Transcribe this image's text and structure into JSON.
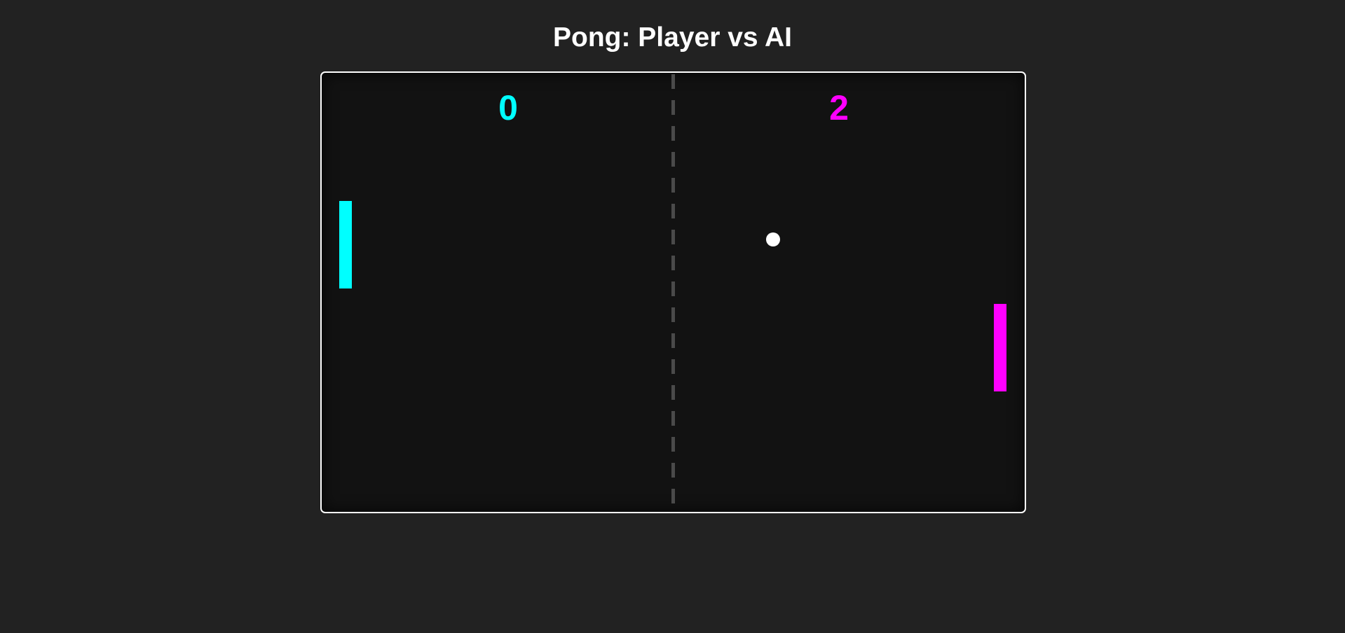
{
  "title": "Pong: Player vs AI",
  "scores": {
    "player": "0",
    "ai": "2"
  },
  "colors": {
    "background": "#222222",
    "board": "#121212",
    "border": "#ffffff",
    "player": "#00ffff",
    "ai": "#ff00ff",
    "ball": "#ffffff",
    "center_line": "#4a4a4a"
  }
}
